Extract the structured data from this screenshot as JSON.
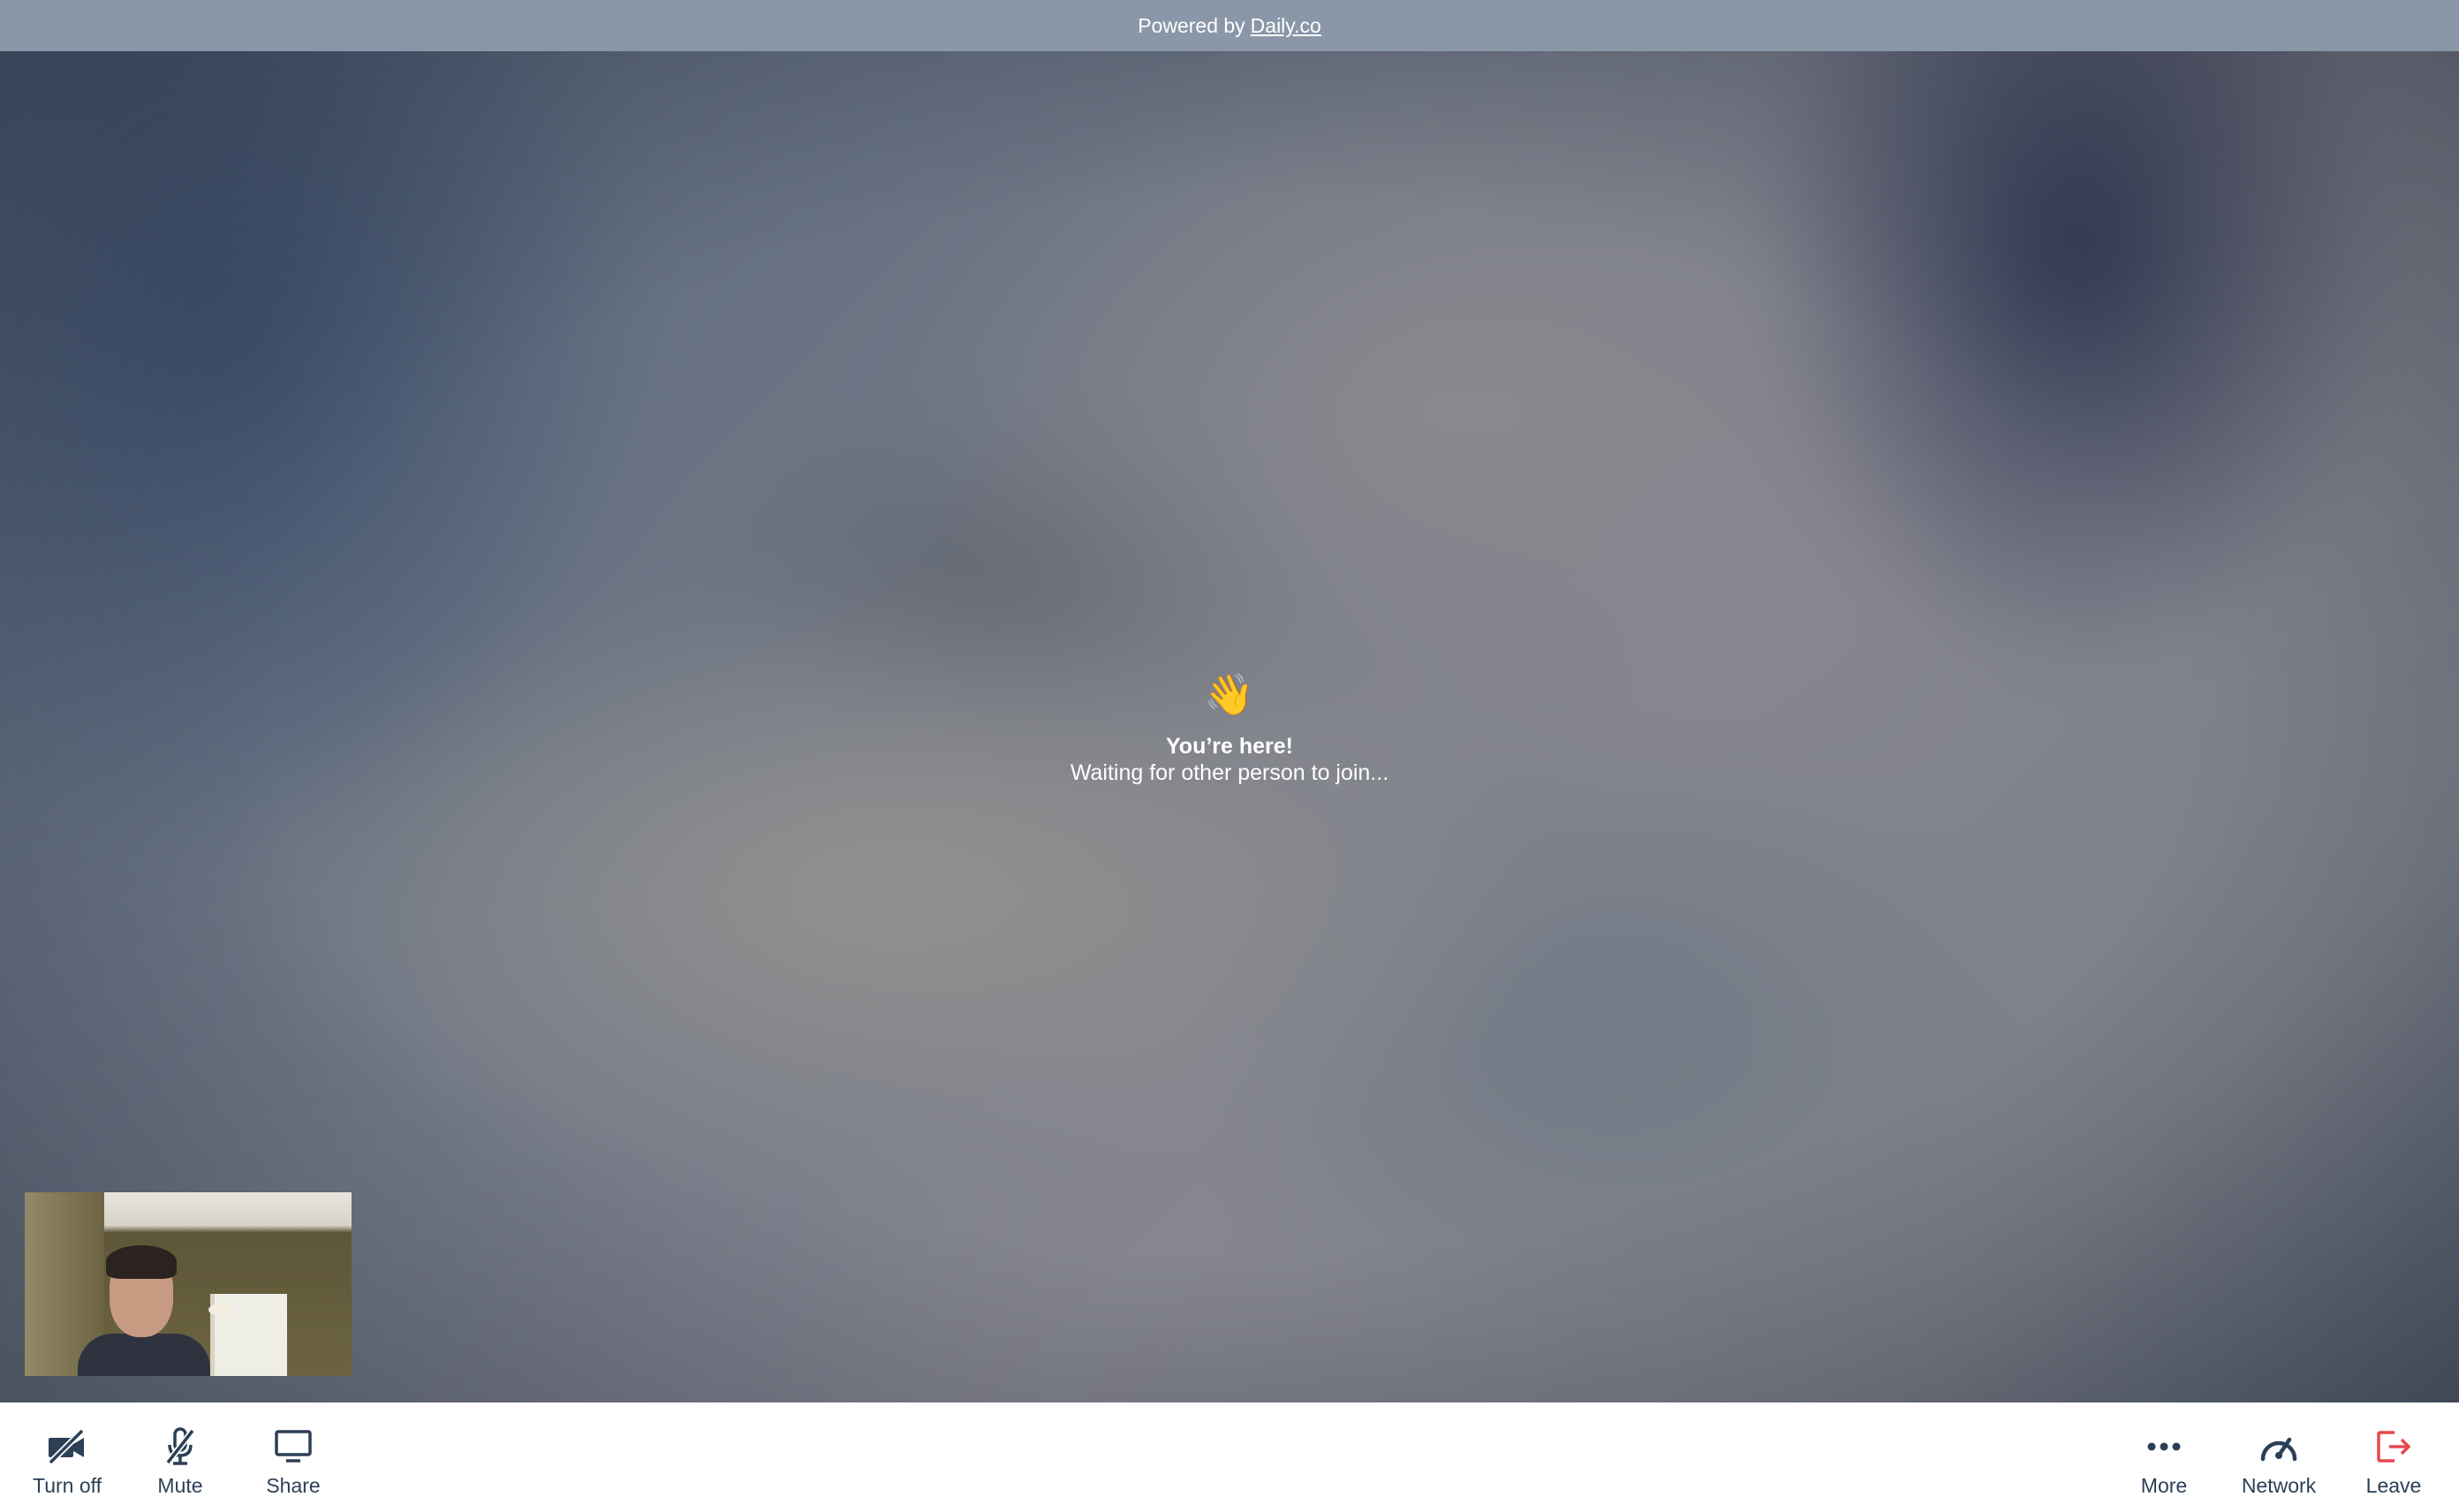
{
  "banner": {
    "prefix": "Powered by",
    "link": "Daily.co"
  },
  "waiting": {
    "emoji": "👋",
    "title": "You’re here!",
    "subtitle": "Waiting for other person to join..."
  },
  "toolbar": {
    "left": [
      {
        "label": "Turn off",
        "icon": "camera-off-icon"
      },
      {
        "label": "Mute",
        "icon": "mic-off-icon"
      },
      {
        "label": "Share",
        "icon": "screen-share-icon"
      }
    ],
    "right": [
      {
        "label": "More",
        "icon": "more-dots-icon"
      },
      {
        "label": "Network",
        "icon": "network-gauge-icon"
      },
      {
        "label": "Leave",
        "icon": "leave-icon"
      }
    ]
  },
  "colors": {
    "banner_bg": "#8a97a8",
    "icon": "#2b3f56",
    "leave_accent": "#e5484d"
  }
}
